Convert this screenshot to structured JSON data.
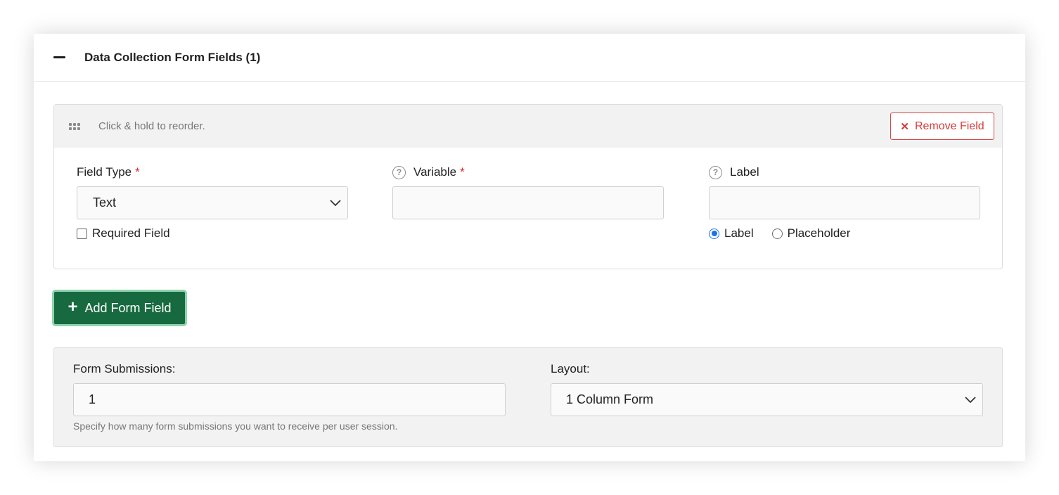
{
  "panel": {
    "title": "Data Collection Form Fields (1)"
  },
  "field_card": {
    "reorder_hint": "Click & hold to reorder.",
    "remove_label": "Remove Field",
    "field_type": {
      "label": "Field Type",
      "required_mark": "*",
      "value": "Text"
    },
    "required_checkbox": {
      "label": "Required Field",
      "checked": false
    },
    "variable": {
      "label": "Variable",
      "required_mark": "*",
      "value": ""
    },
    "label_field": {
      "label": "Label",
      "value": ""
    },
    "display_mode": {
      "options": [
        "Label",
        "Placeholder"
      ],
      "selected": "Label"
    }
  },
  "add_button": {
    "label": "Add Form Field"
  },
  "settings": {
    "submissions": {
      "label": "Form Submissions:",
      "value": "1",
      "hint": "Specify how many form submissions you want to receive per user session."
    },
    "layout": {
      "label": "Layout:",
      "value": "1 Column Form"
    }
  },
  "colors": {
    "add_button_bg": "#176a40",
    "add_button_ring": "#8fd3ae",
    "remove_red": "#d63a3a",
    "radio_blue": "#1a73e8"
  }
}
